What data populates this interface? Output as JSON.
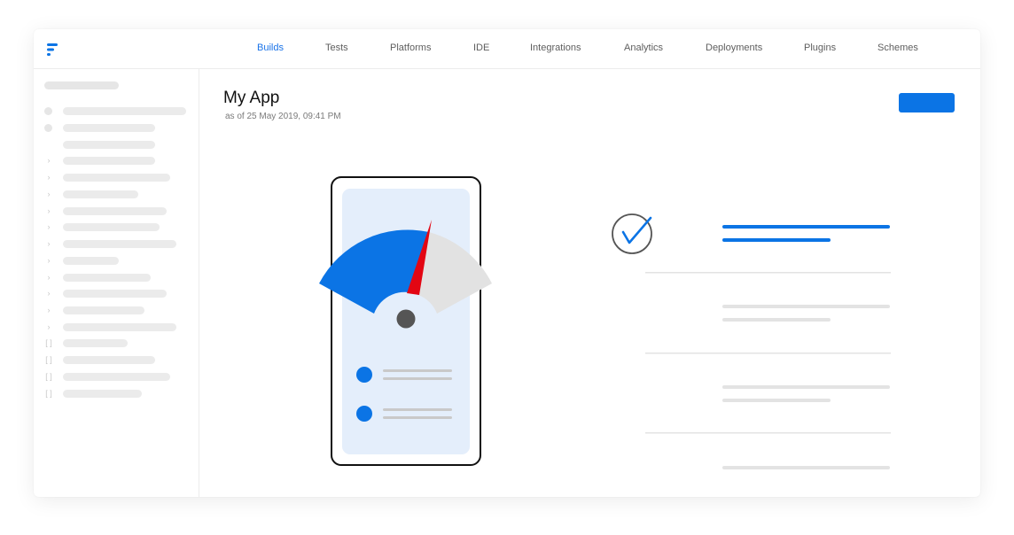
{
  "nav": {
    "items": [
      {
        "label": "Builds",
        "active": true
      },
      {
        "label": "Tests"
      },
      {
        "label": "Platforms"
      },
      {
        "label": "IDE"
      },
      {
        "label": "Integrations"
      },
      {
        "label": "Analytics"
      },
      {
        "label": "Deployments"
      },
      {
        "label": "Plugins"
      },
      {
        "label": "Schemes"
      }
    ]
  },
  "page": {
    "title": "My App",
    "subtitle": "as of 25 May 2019, 09:41 PM"
  },
  "colors": {
    "accent": "#0b74e5",
    "gauge_blue": "#0b74e5",
    "gauge_gray": "#e2e2e2",
    "needle": "#e30613",
    "phone_screen": "#e4eefb"
  },
  "icons": {
    "logo": "fastlane-logo-icon",
    "check": "check-circle-icon"
  }
}
